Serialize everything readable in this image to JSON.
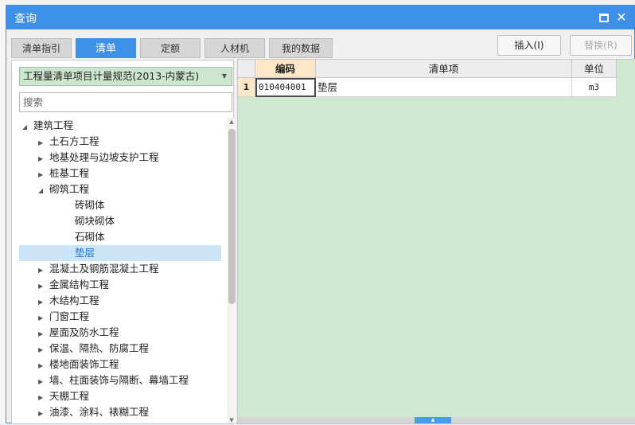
{
  "dialog": {
    "title": "查询"
  },
  "tabs": [
    {
      "label": "清单指引"
    },
    {
      "label": "清单",
      "active": true
    },
    {
      "label": "定额"
    },
    {
      "label": "人材机"
    },
    {
      "label": "我的数据"
    }
  ],
  "toolbar": {
    "insert_label": "插入(I)",
    "replace_label": "替换(R)"
  },
  "left": {
    "standard_selected": "工程量清单项目计量规范(2013-内蒙古)",
    "search_placeholder": "搜索",
    "tree": [
      {
        "label": "建筑工程",
        "level": 0,
        "state": "expanded"
      },
      {
        "label": "土石方工程",
        "level": 1,
        "state": "collapsed"
      },
      {
        "label": "地基处理与边坡支护工程",
        "level": 1,
        "state": "collapsed"
      },
      {
        "label": "桩基工程",
        "level": 1,
        "state": "collapsed"
      },
      {
        "label": "砌筑工程",
        "level": 1,
        "state": "expanded"
      },
      {
        "label": "砖砌体",
        "level": 2,
        "state": "leaf"
      },
      {
        "label": "砌块砌体",
        "level": 2,
        "state": "leaf"
      },
      {
        "label": "石砌体",
        "level": 2,
        "state": "leaf"
      },
      {
        "label": "垫层",
        "level": 2,
        "state": "leaf",
        "selected": true
      },
      {
        "label": "混凝土及钢筋混凝土工程",
        "level": 1,
        "state": "collapsed"
      },
      {
        "label": "金属结构工程",
        "level": 1,
        "state": "collapsed"
      },
      {
        "label": "木结构工程",
        "level": 1,
        "state": "collapsed"
      },
      {
        "label": "门窗工程",
        "level": 1,
        "state": "collapsed"
      },
      {
        "label": "屋面及防水工程",
        "level": 1,
        "state": "collapsed"
      },
      {
        "label": "保温、隔热、防腐工程",
        "level": 1,
        "state": "collapsed"
      },
      {
        "label": "楼地面装饰工程",
        "level": 1,
        "state": "collapsed"
      },
      {
        "label": "墙、柱面装饰与隔断、幕墙工程",
        "level": 1,
        "state": "collapsed"
      },
      {
        "label": "天棚工程",
        "level": 1,
        "state": "collapsed"
      },
      {
        "label": "油漆、涂料、裱糊工程",
        "level": 1,
        "state": "collapsed"
      }
    ]
  },
  "grid": {
    "headers": {
      "code": "编码",
      "item": "清单项",
      "unit": "单位"
    },
    "rows": [
      {
        "num": "1",
        "code": "010404001",
        "item": "垫层",
        "unit": "m3"
      }
    ]
  },
  "colors": {
    "accent": "#3d8fe8",
    "grid_bg": "#cfe8d0",
    "highlight": "#fde7c6",
    "select_bg": "#cde6cf"
  }
}
